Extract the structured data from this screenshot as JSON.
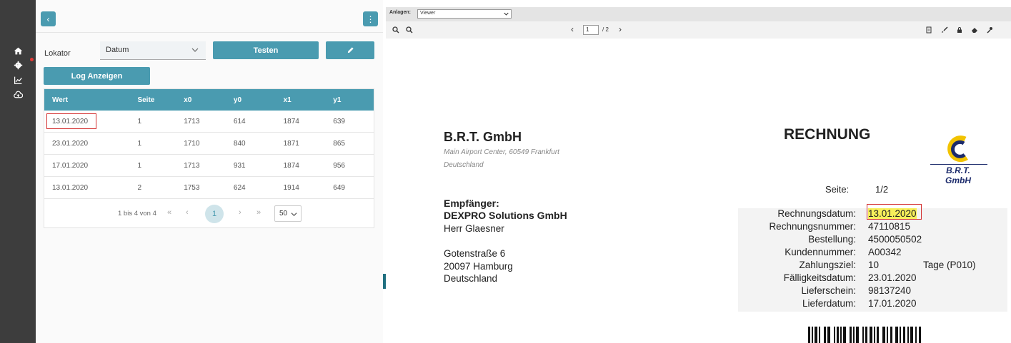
{
  "sidebar": {
    "icons": [
      "home-icon",
      "settings-icon",
      "chart-icon",
      "cloud-upload-icon"
    ]
  },
  "left_panel": {
    "topbar": {
      "back_icon": "chevron-left-icon",
      "menu_icon": "vertical-dots-icon"
    },
    "locator_label": "Lokator",
    "locator_value": "Datum",
    "test_button": "Testen",
    "edit_icon": "pencil-icon",
    "log_button": "Log Anzeigen",
    "table": {
      "headers": [
        "Wert",
        "Seite",
        "x0",
        "y0",
        "x1",
        "y1"
      ],
      "rows": [
        [
          "13.01.2020",
          "1",
          "1713",
          "614",
          "1874",
          "639"
        ],
        [
          "23.01.2020",
          "1",
          "1710",
          "840",
          "1871",
          "865"
        ],
        [
          "17.01.2020",
          "1",
          "1713",
          "931",
          "1874",
          "956"
        ],
        [
          "13.01.2020",
          "2",
          "1753",
          "624",
          "1914",
          "649"
        ]
      ]
    },
    "pager": {
      "info": "1 bis 4 von 4",
      "first": "«",
      "prev": "‹",
      "current": "1",
      "next": "›",
      "last": "»",
      "page_size": "50"
    }
  },
  "viewer": {
    "attachments_label": "Anlagen:",
    "attachments_value": "Viewer",
    "page_input": "1",
    "page_total": "/ 2",
    "prev": "‹",
    "next": "›"
  },
  "document": {
    "company": "B.R.T. GmbH",
    "address1": "Main Airport Center, 60549 Frankfurt",
    "address2": "Deutschland",
    "title": "RECHNUNG",
    "logo_text1": "B.R.T.",
    "logo_text2": "GmbH",
    "seite_label": "Seite:",
    "seite_value": "1/2",
    "recipient_label": "Empfänger:",
    "recipient_name": "DEXPRO Solutions GmbH",
    "recipient_contact": "Herr Glaesner",
    "street": "Gotenstraße 6",
    "city": "20097 Hamburg",
    "country": "Deutschland",
    "fields": [
      {
        "label": "Rechnungsdatum:",
        "value": "13.01.2020"
      },
      {
        "label": "Rechnungsnummer:",
        "value": "47110815"
      },
      {
        "label": "Bestellung:",
        "value": "4500050502"
      },
      {
        "label": "Kundennummer:",
        "value": "A00342"
      },
      {
        "label": "Zahlungsziel:",
        "value": "10"
      },
      {
        "label": "Fälligkeitsdatum:",
        "value": "23.01.2020"
      },
      {
        "label": "Lieferschein:",
        "value": "98137240"
      },
      {
        "label": "Lieferdatum:",
        "value": "17.01.2020"
      }
    ],
    "zahlungsziel_suffix": "Tage (P010)"
  },
  "colors": {
    "accent": "#4a9bb0",
    "sidebar": "#3d3d3d",
    "highlight": "#d32f2f"
  }
}
